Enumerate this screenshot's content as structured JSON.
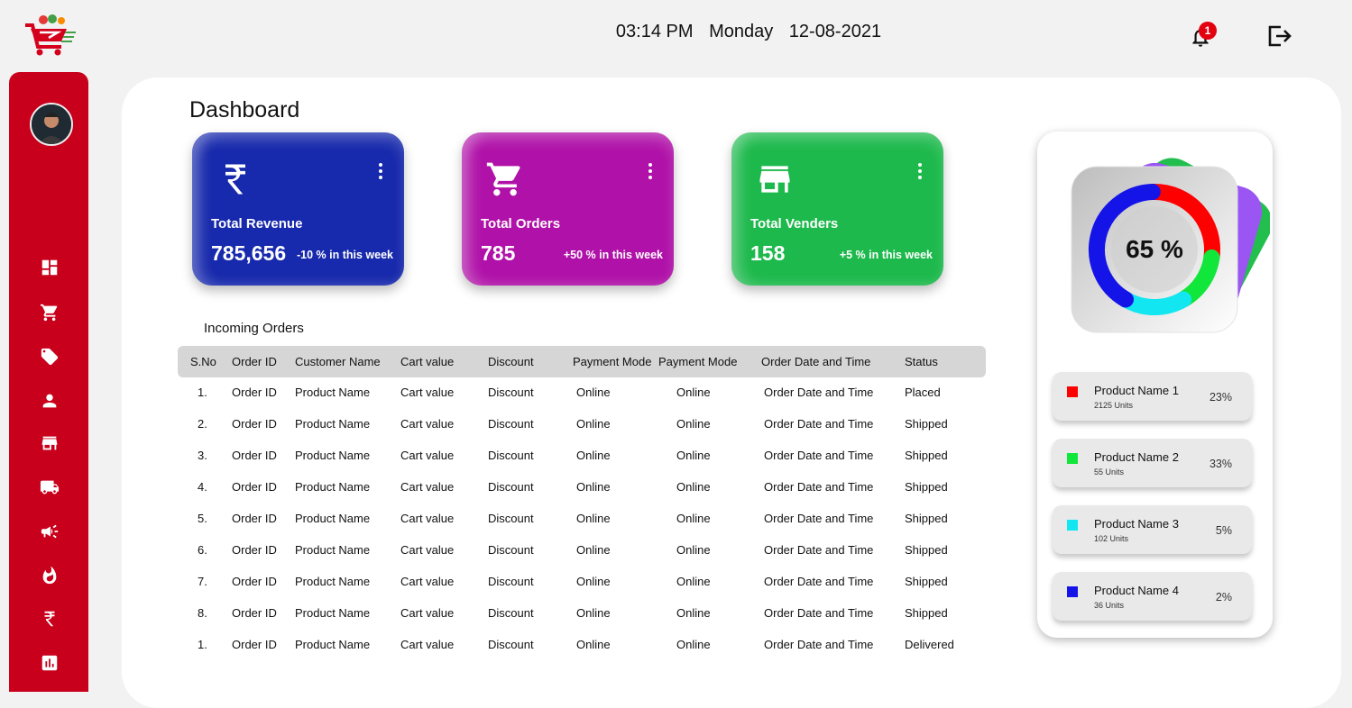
{
  "header": {
    "time": "03:14 PM",
    "day": "Monday",
    "date": "12-08-2021",
    "notification_count": "1"
  },
  "sidebar": {
    "icons": [
      "dashboard-icon",
      "cart-icon",
      "tag-icon",
      "user-icon",
      "store-icon",
      "truck-icon",
      "megaphone-icon",
      "flame-icon",
      "rupee-icon",
      "report-icon"
    ]
  },
  "page": {
    "title": "Dashboard"
  },
  "cards": [
    {
      "label": "Total Revenue",
      "value": "785,656",
      "change": "-10 % in this week",
      "color": "#1729ac",
      "icon": "rupee-icon"
    },
    {
      "label": "Total Orders",
      "value": "785",
      "change": "+50 % in this week",
      "color": "#b011a8",
      "icon": "cart-icon"
    },
    {
      "label": "Total Venders",
      "value": "158",
      "change": "+5 % in this week",
      "color": "#1db94c",
      "icon": "store-icon"
    }
  ],
  "orders": {
    "title": "Incoming Orders",
    "columns": [
      "S.No",
      "Order ID",
      "Customer Name",
      "Cart value",
      "Discount",
      "Payment Mode",
      "Payment Mode",
      "Order Date and Time",
      "Status"
    ],
    "rows": [
      [
        "1.",
        "Order ID",
        "Product Name",
        "Cart value",
        "Discount",
        "Online",
        "Online",
        "Order Date and Time",
        "Placed"
      ],
      [
        "2.",
        "Order ID",
        "Product Name",
        "Cart value",
        "Discount",
        "Online",
        "Online",
        "Order Date and Time",
        "Shipped"
      ],
      [
        "3.",
        "Order ID",
        "Product Name",
        "Cart value",
        "Discount",
        "Online",
        "Online",
        "Order Date and Time",
        "Shipped"
      ],
      [
        "4.",
        "Order ID",
        "Product Name",
        "Cart value",
        "Discount",
        "Online",
        "Online",
        "Order Date and Time",
        "Shipped"
      ],
      [
        "5.",
        "Order ID",
        "Product Name",
        "Cart value",
        "Discount",
        "Online",
        "Online",
        "Order Date and Time",
        "Shipped"
      ],
      [
        "6.",
        "Order ID",
        "Product Name",
        "Cart value",
        "Discount",
        "Online",
        "Online",
        "Order Date and Time",
        "Shipped"
      ],
      [
        "7.",
        "Order ID",
        "Product Name",
        "Cart value",
        "Discount",
        "Online",
        "Online",
        "Order Date and Time",
        "Shipped"
      ],
      [
        "8.",
        "Order ID",
        "Product Name",
        "Cart value",
        "Discount",
        "Online",
        "Online",
        "Order Date and Time",
        "Shipped"
      ],
      [
        "1.",
        "Order ID",
        "Product Name",
        "Cart value",
        "Discount",
        "Online",
        "Online",
        "Order Date and Time",
        "Delivered"
      ]
    ]
  },
  "products": {
    "center_label": "65 %",
    "items": [
      {
        "name": "Product Name 1",
        "units": "2125 Units",
        "percent": "23%",
        "color": "#ff0000"
      },
      {
        "name": "Product Name 2",
        "units": "55 Units",
        "percent": "33%",
        "color": "#11e63a"
      },
      {
        "name": "Product Name 3",
        "units": "102 Units",
        "percent": "5%",
        "color": "#12e6f0"
      },
      {
        "name": "Product Name 4",
        "units": "36 Units",
        "percent": "2%",
        "color": "#1414e8"
      }
    ]
  }
}
